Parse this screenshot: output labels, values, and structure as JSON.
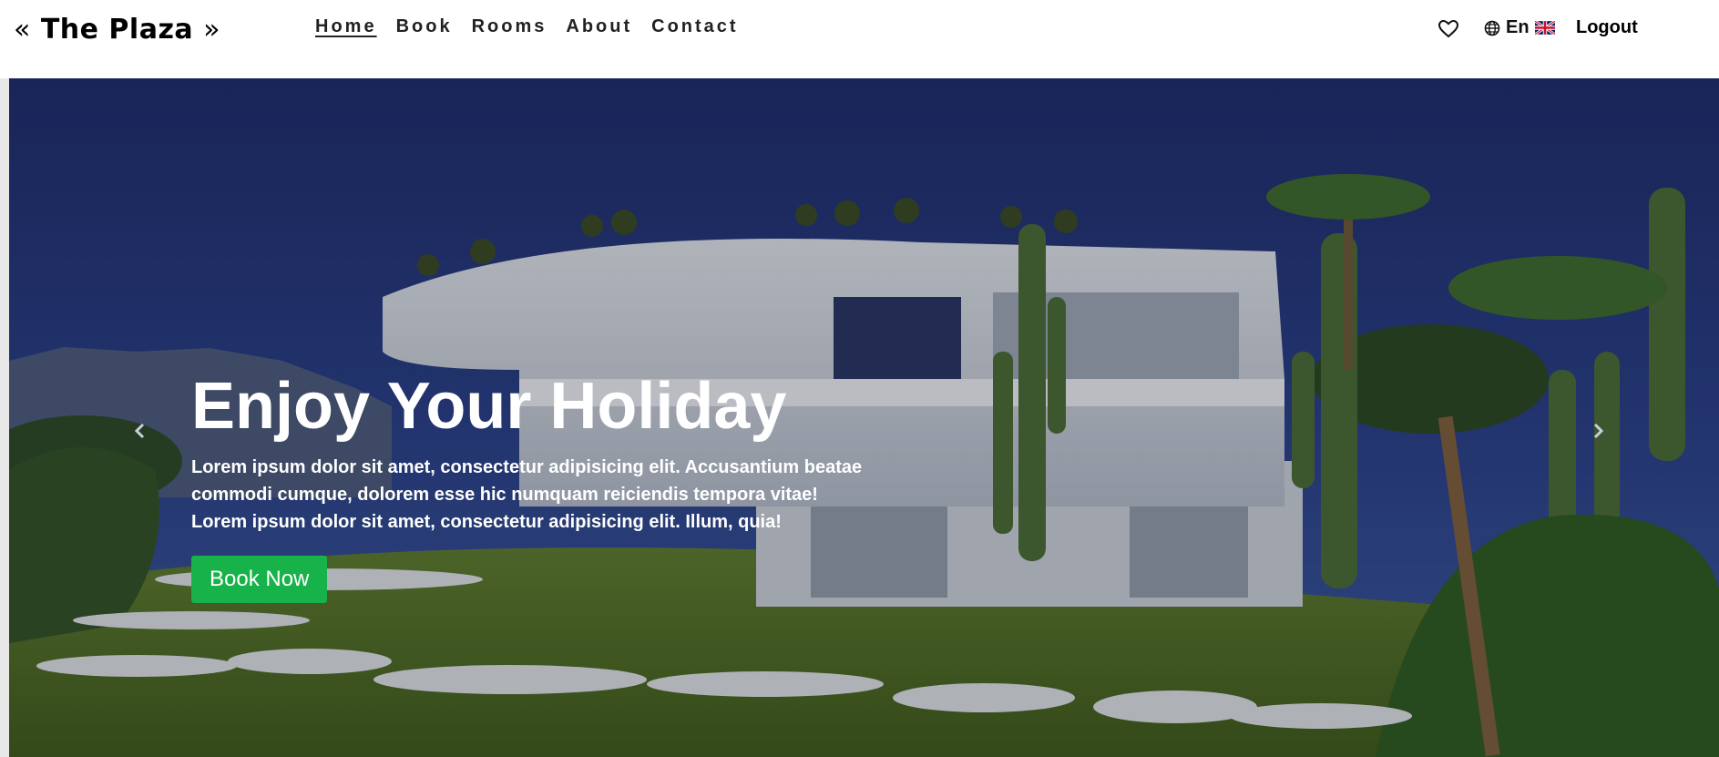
{
  "header": {
    "brand_left": "«",
    "brand_name": "The Plaza",
    "brand_right": "»",
    "nav": [
      {
        "label": "Home",
        "active": true
      },
      {
        "label": "Book",
        "active": false
      },
      {
        "label": "Rooms",
        "active": false
      },
      {
        "label": "About",
        "active": false
      },
      {
        "label": "Contact",
        "active": false
      }
    ],
    "favorites_icon": "heart-icon",
    "language": {
      "icon": "globe-icon",
      "label": "En",
      "flag": "uk-flag-icon"
    },
    "logout_label": "Logout"
  },
  "hero": {
    "title": "Enjoy Your Holiday",
    "text": "Lorem ipsum dolor sit amet, consectetur adipisicing elit. Accusantium beatae commodi cumque, dolorem esse hic numquam reiciendis tempora vitae! Lorem ipsum dolor sit amet, consectetur adipisicing elit. Illum, quia!",
    "button_label": "Book Now",
    "prev_icon": "chevron-left-icon",
    "next_icon": "chevron-right-icon"
  },
  "colors": {
    "accent_button": "#17b24a",
    "sky": "#1f2b63",
    "text_dark": "#222222"
  }
}
